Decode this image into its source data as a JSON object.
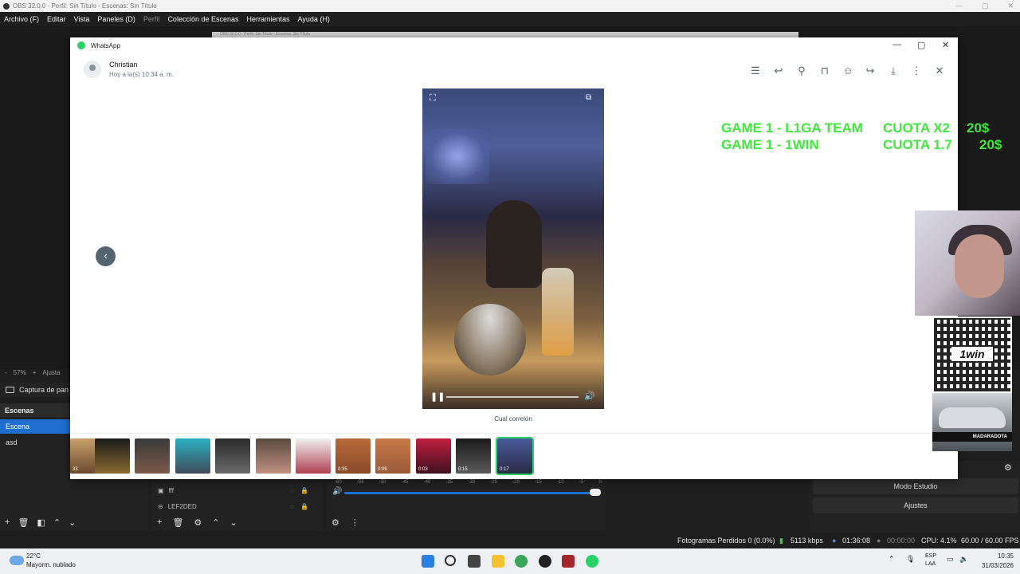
{
  "obs": {
    "title": "OBS 32.0.0 - Perfil: Sin Título - Escenas: Sin Título",
    "menu": [
      "Archivo (F)",
      "Editar",
      "Vista",
      "Paneles (D)",
      "Perfil",
      "Colección de Escenas",
      "Herramientas",
      "Ayuda (H)"
    ],
    "ghost_window_title": "OBS 32.0.0 - Perfil: Sin Título - Escenas: Sin Título",
    "zoom": "57%",
    "zoom_plus": "+",
    "zoom_minus": "-",
    "zoom_fit": "Ajusta",
    "capture_label": "Captura de pan",
    "scenes_header": "Escenas",
    "scenes": [
      "Escena",
      "asd"
    ],
    "sources": [
      "fff",
      "LEF2DED"
    ],
    "mixer_scale": [
      "-60",
      "-55",
      "-50",
      "-45",
      "-40",
      "-35",
      "-30",
      "-25",
      "-20",
      "-15",
      "-10",
      "-5",
      "0"
    ],
    "controls": {
      "studio_mode": "Modo Estudio",
      "settings": "Ajustes"
    },
    "status": {
      "dropped_frames": "Fotogramas Perdidos 0 (0.0%)",
      "bitrate": "5113 kbps",
      "live_time": "01:36:08",
      "rec_time": "00:00:00",
      "cpu": "CPU: 4.1%",
      "fps": "60.00 / 60.00 FPS"
    }
  },
  "whatsapp": {
    "window_title": "WhatsApp",
    "sender": "Christian",
    "timestamp": "Hoy a la(s) 10:34 a. m.",
    "caption": "Cual correlón",
    "thumbnails": [
      {
        "duration": "33"
      },
      {
        "duration": ""
      },
      {
        "duration": ""
      },
      {
        "duration": ""
      },
      {
        "duration": ""
      },
      {
        "duration": ""
      },
      {
        "duration": ""
      },
      {
        "duration": "0:35"
      },
      {
        "duration": "0:09"
      },
      {
        "duration": "0:03"
      },
      {
        "duration": "0:15"
      },
      {
        "duration": "0:17"
      }
    ]
  },
  "overlay": {
    "odds": [
      {
        "game": "GAME 1 - L1GA TEAM",
        "quota": "CUOTA X2",
        "amount": "20$"
      },
      {
        "game": "GAME 1 - 1WIN",
        "quota": "CUOTA 1.7",
        "amount": "20$"
      }
    ],
    "qr_brand": "1win",
    "car_label": "MADARADOTA"
  },
  "taskbar": {
    "temperature": "22°C",
    "weather": "Mayorm. nublado",
    "lang": "ESP",
    "lang_sub": "LAA",
    "time": "10:35",
    "date": "31/03/2026"
  },
  "colors": {
    "accent": "#1e6fd0",
    "whatsapp": "#25d366",
    "overlay_green": "#3fe83b"
  }
}
